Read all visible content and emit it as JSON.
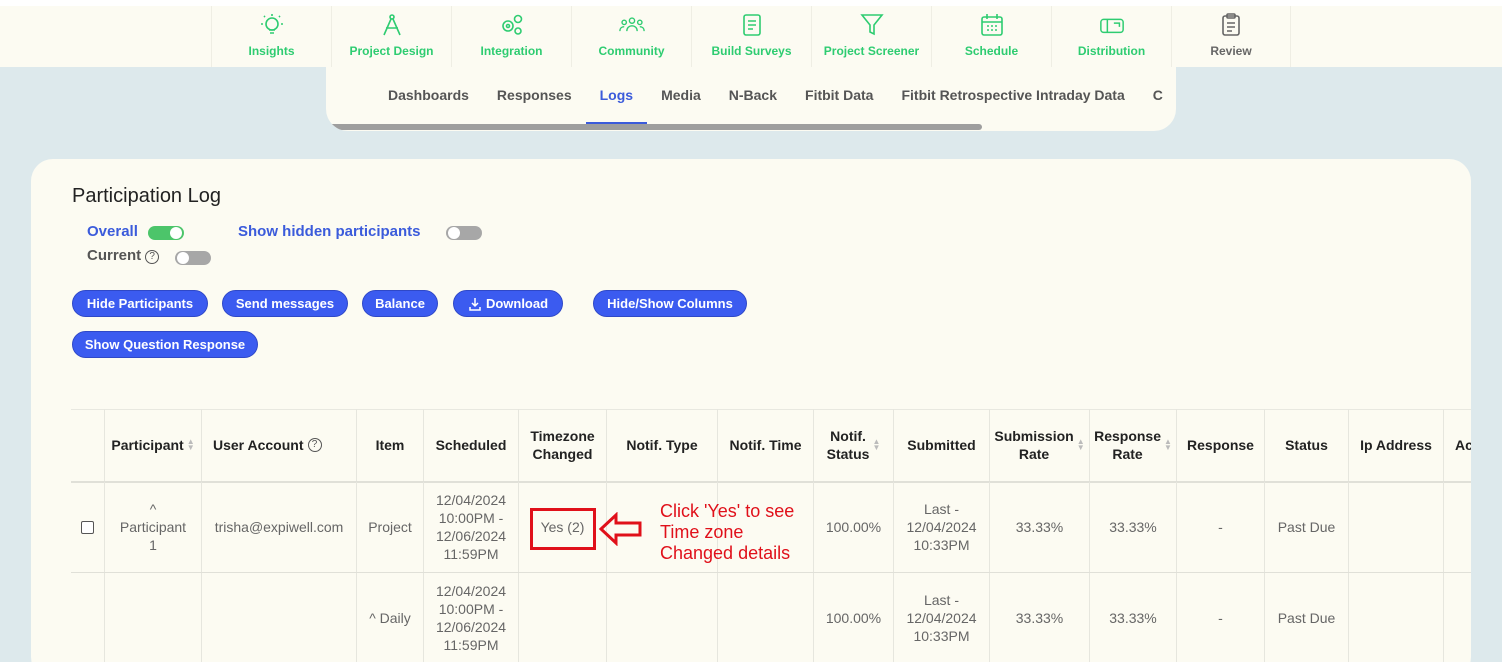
{
  "topnav": {
    "items": [
      {
        "label": "Insights",
        "icon": "lightbulb-icon"
      },
      {
        "label": "Project Design",
        "icon": "compass-icon"
      },
      {
        "label": "Integration",
        "icon": "gears-icon"
      },
      {
        "label": "Community",
        "icon": "people-icon"
      },
      {
        "label": "Build Surveys",
        "icon": "form-icon"
      },
      {
        "label": "Project Screener",
        "icon": "filter-icon"
      },
      {
        "label": "Schedule",
        "icon": "calendar-icon"
      },
      {
        "label": "Distribution",
        "icon": "mailbox-icon"
      },
      {
        "label": "Review",
        "icon": "clipboard-icon"
      }
    ],
    "accent_color": "#2ecc71"
  },
  "subtabs": {
    "items": [
      "Dashboards",
      "Responses",
      "Logs",
      "Media",
      "N-Back",
      "Fitbit Data",
      "Fitbit Retrospective Intraday Data",
      "C"
    ],
    "active": "Logs"
  },
  "log": {
    "title": "Participation Log",
    "overall_label": "Overall",
    "current_label": "Current",
    "hidden_label": "Show hidden participants",
    "help_glyph": "?",
    "buttons": {
      "hide": "Hide Participants",
      "send": "Send messages",
      "balance": "Balance",
      "download": "Download",
      "columns": "Hide/Show Columns",
      "question": "Show Question Response"
    }
  },
  "table": {
    "headers": {
      "participant": "Participant",
      "user_account": "User Account",
      "item": "Item",
      "scheduled": "Scheduled",
      "timezone1": "Timezone",
      "timezone2": "Changed",
      "notif_type": "Notif. Type",
      "notif_time": "Notif. Time",
      "notif_status1": "Notif.",
      "notif_status2": "Status",
      "submitted": "Submitted",
      "submission1": "Submission",
      "submission2": "Rate",
      "response_rate1": "Response",
      "response_rate2": "Rate",
      "response": "Response",
      "status": "Status",
      "ip": "Ip Address",
      "extra": "Ac"
    },
    "rows": [
      {
        "caret": "^",
        "participant1": "Participant",
        "participant2": "1",
        "user_account": "trisha@expiwell.com",
        "item": "Project",
        "sched1": "12/04/2024",
        "sched2": "10:00PM -",
        "sched3": "12/06/2024",
        "sched4": "11:59PM",
        "timezone": "Yes (2)",
        "notif_status": "100.00%",
        "sub1": "Last -",
        "sub2": "12/04/2024",
        "sub3": "10:33PM",
        "submission_rate": "33.33%",
        "response_rate": "33.33%",
        "response": "-",
        "status": "Past Due"
      },
      {
        "item": "^ Daily",
        "sched1": "12/04/2024",
        "sched2": "10:00PM -",
        "sched3": "12/06/2024",
        "sched4": "11:59PM",
        "notif_status": "100.00%",
        "sub1": "Last -",
        "sub2": "12/04/2024",
        "sub3": "10:33PM",
        "submission_rate": "33.33%",
        "response_rate": "33.33%",
        "response": "-",
        "status": "Past Due"
      }
    ]
  },
  "annotation": {
    "line1": "Click 'Yes' to see",
    "line2": "Time zone",
    "line3": "Changed details",
    "color": "#e0101a"
  }
}
